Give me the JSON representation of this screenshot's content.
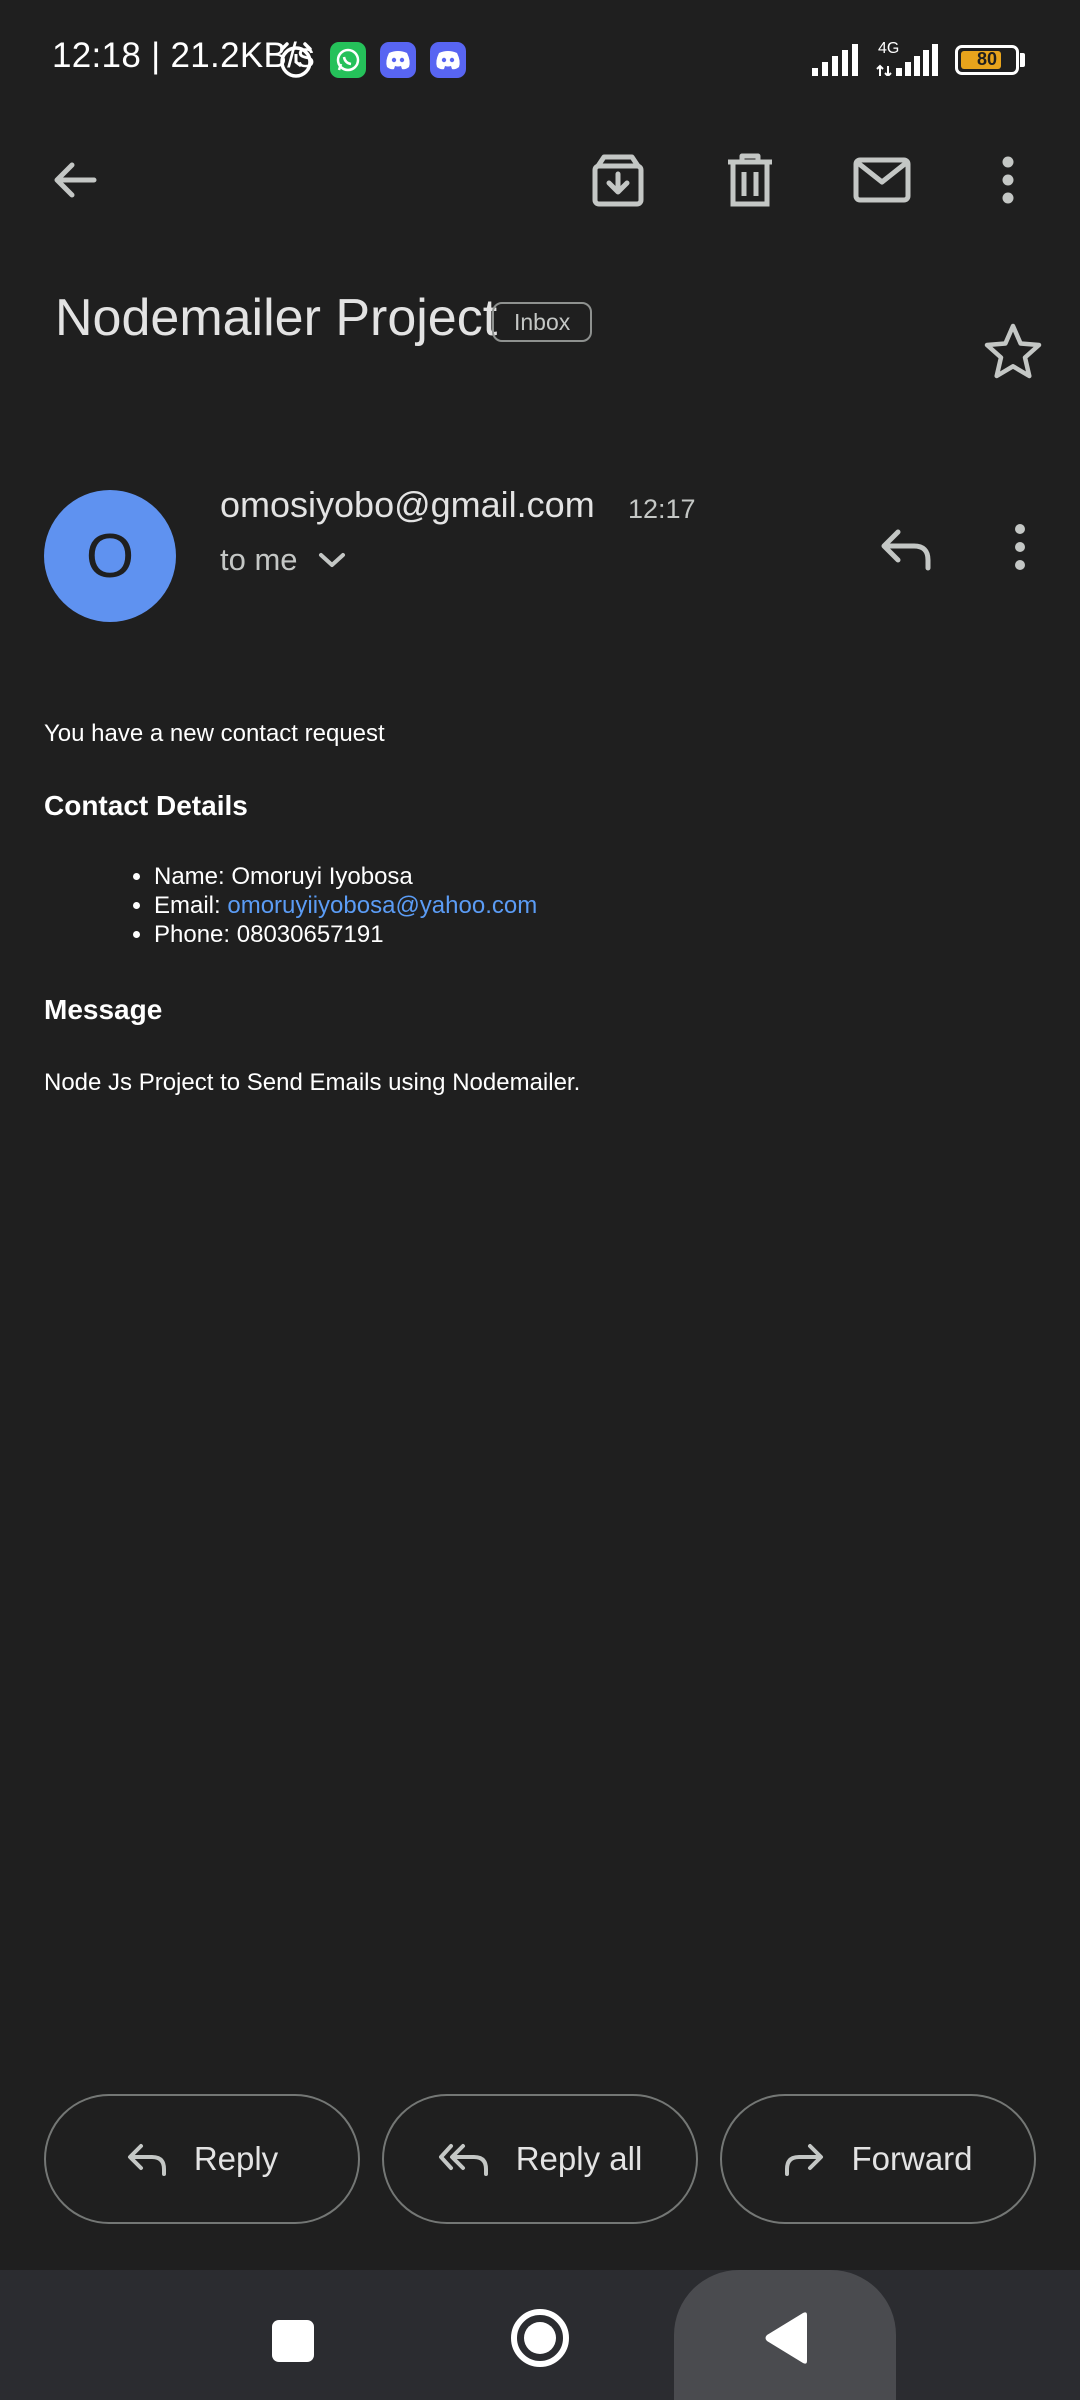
{
  "status_bar": {
    "text": "12:18 | 21.2KB/s",
    "network": "4G",
    "battery": "80",
    "battery_level": 0.8
  },
  "toolbar": {
    "back_icon": "arrow-left-icon",
    "archive_icon": "archive-icon",
    "delete_icon": "trash-icon",
    "mark_unread_icon": "mail-icon",
    "more_icon": "more-vert-icon"
  },
  "email": {
    "subject": "Nodemailer Project",
    "label": "Inbox",
    "sender_initial": "O",
    "sender": "omosiyobo@gmail.com",
    "time": "12:17",
    "recipient": "to me",
    "intro": "You have a new contact request",
    "contact_heading": "Contact Details",
    "contact": {
      "name_label": "Name:",
      "name": "Omoruyi Iyobosa",
      "email_label": "Email:",
      "email": "omoruyiiyobosa@yahoo.com",
      "phone_label": "Phone:",
      "phone": "08030657191"
    },
    "message_heading": "Message",
    "message": "Node Js Project to Send Emails using Nodemailer."
  },
  "actions": {
    "reply": "Reply",
    "reply_all": "Reply all",
    "forward": "Forward"
  },
  "colors": {
    "background": "#1f1f1f",
    "avatar": "#5f92f0",
    "link": "#5b9cf5",
    "battery": "#e8a41c"
  }
}
